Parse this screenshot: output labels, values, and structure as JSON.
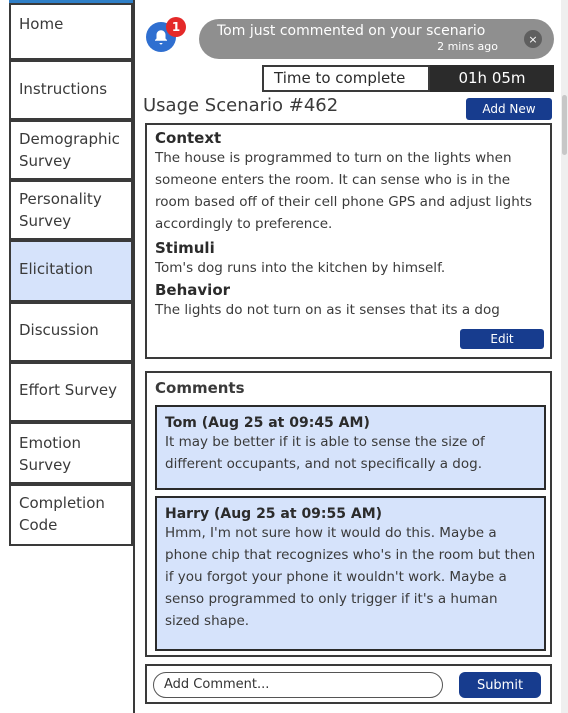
{
  "sidebar": {
    "items": [
      {
        "label": "Home"
      },
      {
        "label": "Instructions"
      },
      {
        "label": "Demographic Survey"
      },
      {
        "label": "Personality Survey"
      },
      {
        "label": "Elicitation"
      },
      {
        "label": "Discussion"
      },
      {
        "label": "Effort Survey"
      },
      {
        "label": "Emotion Survey"
      },
      {
        "label": "Completion Code"
      }
    ],
    "active": "Elicitation"
  },
  "notification": {
    "badge": "1",
    "text": "Tom just commented on your scenario",
    "time": "2 mins ago",
    "close": "×"
  },
  "timer": {
    "label": "Time to complete",
    "value": "01h 05m"
  },
  "scenario": {
    "title": "Usage Scenario #462",
    "add_new": "Add New",
    "edit": "Edit",
    "context_head": "Context",
    "context_body": "The house is programmed to turn on the lights when someone enters the room. It can sense who is in the room based off of their cell phone GPS and adjust lights accordingly to preference.",
    "stimuli_head": "Stimuli",
    "stimuli_body": "Tom's dog runs into the kitchen by himself.",
    "behavior_head": "Behavior",
    "behavior_body": "The lights do not turn on as it senses that its a dog"
  },
  "comments": {
    "title": "Comments",
    "items": [
      {
        "author": "Tom (Aug 25 at 09:45 AM)",
        "text": "It may be better if it is able to sense the size of different occupants, and not specifically a dog."
      },
      {
        "author": "Harry (Aug 25 at 09:55 AM)",
        "text": "Hmm, I'm not sure how it would do this. Maybe a phone chip that recognizes who's in the room but then if you forgot your phone it wouldn't work. Maybe a senso programmed to only trigger if it's a human sized shape."
      }
    ]
  },
  "add_comment": {
    "placeholder": "Add Comment...",
    "submit": "Submit"
  },
  "colors": {
    "accent": "#173c8e",
    "active_bg": "#d6e3fb",
    "notif_pill": "#8f8f8f",
    "badge": "#e42929"
  }
}
